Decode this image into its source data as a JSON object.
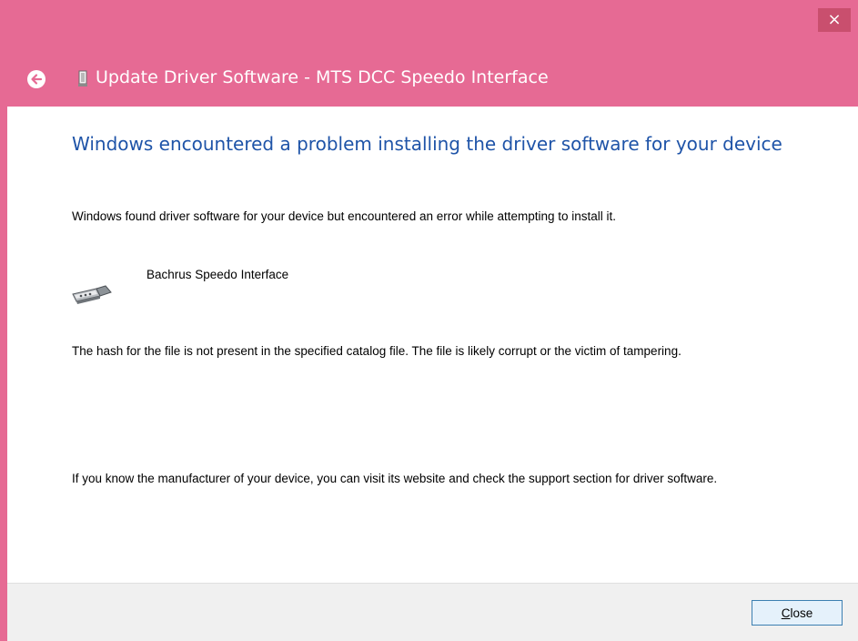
{
  "window": {
    "title": "Update Driver Software - MTS DCC Speedo Interface",
    "close_glyph": "×",
    "frame_color": "#e66a94"
  },
  "icons": {
    "back": "back-arrow-icon",
    "title_device": "device-icon",
    "device": "usb-device-icon"
  },
  "main": {
    "headline": "Windows encountered a problem installing the driver software for your device",
    "intro": "Windows found driver software for your device but encountered an error while attempting to install it.",
    "device_name": "Bachrus Speedo Interface",
    "error_detail": "The hash for the file is not present in the specified catalog file. The file is likely corrupt or the victim of tampering.",
    "help_text": "If you know the manufacturer of your device, you can visit its website and check the support section for driver software."
  },
  "footer": {
    "close_label_mnemonic": "C",
    "close_label_rest": "lose"
  }
}
